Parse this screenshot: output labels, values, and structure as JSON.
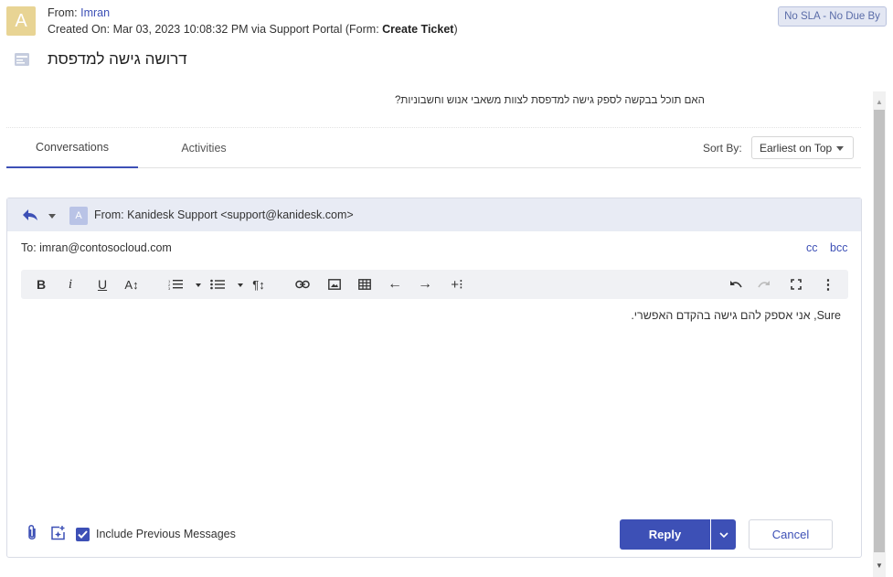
{
  "header": {
    "avatar_letter": "A",
    "from_label": "From: ",
    "from_name": "Imran",
    "created_prefix": "Created On: Mar 03, 2023 10:08:32 PM via Support Portal (Form: ",
    "form_name": "Create Ticket",
    "created_suffix": ")",
    "sla_badge": "No SLA - No Due By",
    "ticket_title": "דרושה גישה למדפסת"
  },
  "ticket_body": {
    "question": "האם תוכל בבקשה לספק גישה למדפסת לצוות משאבי אנוש וחשבוניות?"
  },
  "tabs": [
    {
      "label": "Conversations",
      "active": true
    },
    {
      "label": "Activities",
      "active": false
    }
  ],
  "sort": {
    "label": "Sort By:",
    "value": "Earliest on Top"
  },
  "composer": {
    "avatar_letter": "A",
    "from": "From: Kanidesk Support <support@kanidesk.com>",
    "to": "To: imran@contosocloud.com",
    "cc_label": "cc",
    "bcc_label": "bcc",
    "toolbar": {
      "bold": "B",
      "italic": "i",
      "underline": "U",
      "font_size": "A↕",
      "paragraph": "¶↕"
    },
    "body_text": "Sure, אני אספק להם גישה בהקדם האפשרי.",
    "include_previous_label": "Include Previous Messages",
    "include_previous_checked": true,
    "reply_label": "Reply",
    "cancel_label": "Cancel"
  },
  "colors": {
    "accent": "#3d50b6",
    "avatar_customer": "#e8d494",
    "avatar_agent": "#b9c3e6",
    "composer_header": "#e8ebf4"
  }
}
